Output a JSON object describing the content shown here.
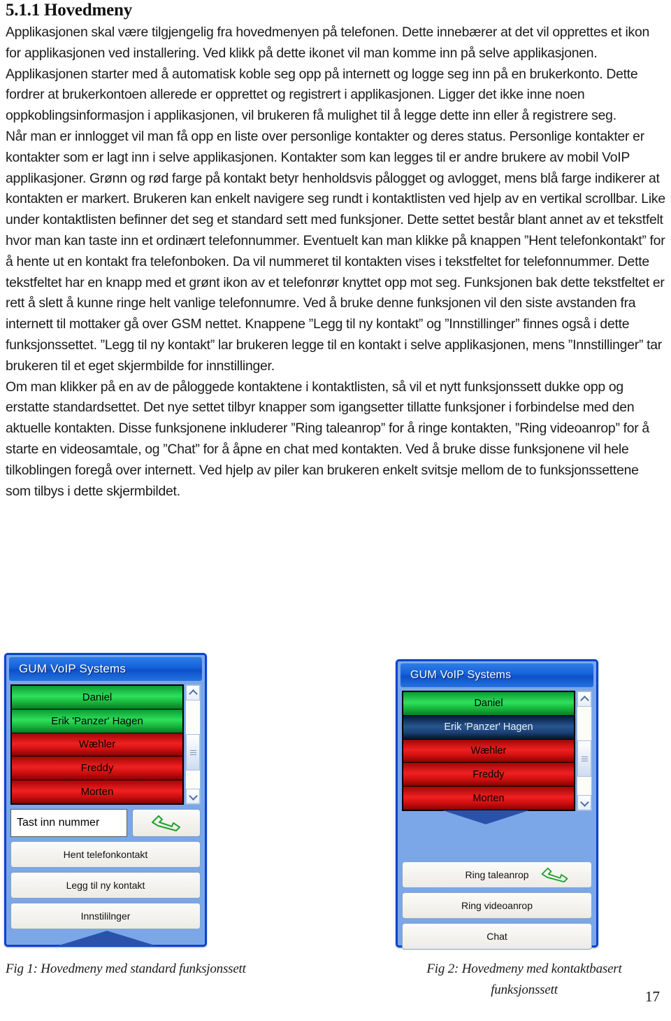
{
  "document": {
    "heading": "5.1.1 Hovedmeny",
    "paragraphs": [
      "Applikasjonen skal være tilgjengelig fra hovedmenyen på telefonen. Dette innebærer at det vil opprettes et ikon for applikasjonen ved installering. Ved klikk på dette ikonet vil man komme inn på selve applikasjonen. Applikasjonen starter med å automatisk koble seg opp på internett og logge seg inn på en brukerkonto. Dette fordrer at brukerkontoen allerede er opprettet og registrert i applikasjonen. Ligger det ikke inne noen oppkoblingsinformasjon i applikasjonen, vil brukeren få mulighet til å legge dette inn eller å registrere seg.",
      "Når man er innlogget vil man få opp en liste over personlige kontakter og deres status. Personlige kontakter er kontakter som er lagt inn i selve applikasjonen. Kontakter som kan legges til er andre brukere av mobil VoIP applikasjoner. Grønn og rød farge på kontakt betyr henholdsvis pålogget og avlogget, mens blå farge indikerer at kontakten er markert. Brukeren kan enkelt navigere seg rundt i kontaktlisten ved hjelp av en vertikal scrollbar. Like under kontaktlisten befinner det seg et standard sett med funksjoner. Dette settet består blant annet av et tekstfelt hvor man kan taste inn et ordinært telefonnummer. Eventuelt kan man klikke på knappen ”Hent telefonkontakt” for å hente ut en kontakt fra telefonboken. Da vil nummeret til kontakten vises i tekstfeltet for telefonnummer. Dette tekstfeltet har en knapp med et grønt ikon av et telefonrør knyttet opp mot seg. Funksjonen bak dette tekstfeltet er rett å slett å kunne ringe helt vanlige telefonnumre. Ved å bruke denne funksjonen vil den siste avstanden fra internett til mottaker gå over GSM nettet. Knappene ”Legg til ny kontakt” og ”Innstillinger” finnes også i dette funksjonssettet. ”Legg til ny kontakt” lar brukeren legge til en kontakt i selve applikasjonen, mens ”Innstillinger” tar brukeren til et eget skjermbilde for innstillinger.",
      "Om man klikker på en av de påloggede kontaktene i kontaktlisten, så vil et nytt funksjonssett dukke opp og erstatte standardsettet. Det nye settet tilbyr knapper som igangsetter tillatte funksjoner i forbindelse med den aktuelle kontakten. Disse funksjonene inkluderer ”Ring taleanrop” for å ringe kontakten, ”Ring videoanrop” for å starte en videosamtale, og ”Chat” for å åpne en chat med kontakten. Ved å bruke disse funksjonene vil hele tilkoblingen foregå over internett. Ved hjelp av piler kan brukeren enkelt svitsje mellom de to funksjonssettene som tilbys i dette skjermbildet."
    ],
    "page_number": "17"
  },
  "figure1": {
    "caption": "Fig 1: Hovedmeny med standard funksjonssett",
    "app": {
      "title": "GUM VoIP Systems",
      "contacts": [
        {
          "name": "Daniel",
          "status": "online"
        },
        {
          "name": "Erik 'Panzer' Hagen",
          "status": "online"
        },
        {
          "name": "Wæhler",
          "status": "offline"
        },
        {
          "name": "Freddy",
          "status": "offline"
        },
        {
          "name": "Morten",
          "status": "offline"
        }
      ],
      "number_field_value": "Tast inn nummer",
      "call_button_icon": "phone-handset-icon",
      "buttons": [
        "Hent telefonkontakt",
        "Legg til ny kontakt",
        "Innstililnger"
      ]
    }
  },
  "figure2": {
    "caption": "Fig 2: Hovedmeny med kontaktbasert funksjonssett",
    "app": {
      "title": "GUM VoIP Systems",
      "contacts": [
        {
          "name": "Daniel",
          "status": "online"
        },
        {
          "name": "Erik 'Panzer' Hagen",
          "status": "selected"
        },
        {
          "name": "Wæhler",
          "status": "offline"
        },
        {
          "name": "Freddy",
          "status": "offline"
        },
        {
          "name": "Morten",
          "status": "offline"
        }
      ],
      "buttons": [
        "Ring taleanrop",
        "Ring videoanrop",
        "Chat"
      ],
      "call_button_icon": "phone-handset-icon"
    }
  },
  "colors": {
    "frame_border": "#0a43d0",
    "frame_body": "#7ba7e8",
    "titlebar": "#1560d8",
    "online": "#18b83c",
    "offline": "#d01010",
    "selected": "#27558f",
    "arrow": "#2a52ab",
    "handset_icon": "#23a02f"
  }
}
